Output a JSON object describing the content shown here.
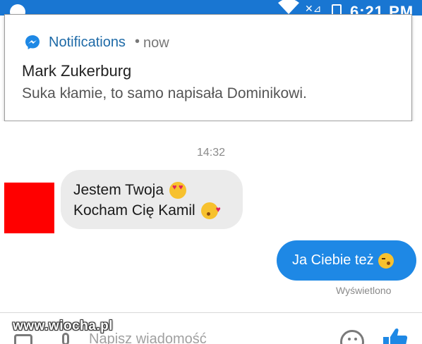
{
  "status_bar": {
    "time": "6:21 PM",
    "left_icon": "app-icon",
    "signal_icon": "wifi-icon",
    "sim_icon": "no-sim-icon",
    "battery_icon": "battery-icon"
  },
  "notification": {
    "icon": "messenger-icon",
    "app_name": "Notifications",
    "separator": "•",
    "time": "now",
    "sender": "Mark Zukerburg",
    "message": "Suka kłamie, to samo napisała Dominikowi."
  },
  "chat": {
    "timestamp": "14:32",
    "incoming": {
      "avatar_color": "#ff0000",
      "lines": [
        {
          "text": "Jestem Twoja",
          "emoji": "heart-eyes-emoji"
        },
        {
          "text": "Kocham Cię Kamil",
          "emoji": "kissing-heart-emoji"
        }
      ]
    },
    "outgoing": {
      "text": "Ja Ciebie też",
      "emoji": "wink-kiss-emoji",
      "color": "#1e88e5"
    },
    "seen_label": "Wyświetlono"
  },
  "input_bar": {
    "placeholder": "Napisz wiadomość",
    "camera_icon": "camera-icon",
    "mic_icon": "microphone-icon",
    "emoji_icon": "smiley-icon",
    "like_icon": "thumbs-up-icon"
  },
  "watermark": "www.wiocha.pl",
  "colors": {
    "status_bar": "#1976d2",
    "accent": "#1e88e5",
    "incoming_bubble": "#ebebeb"
  }
}
